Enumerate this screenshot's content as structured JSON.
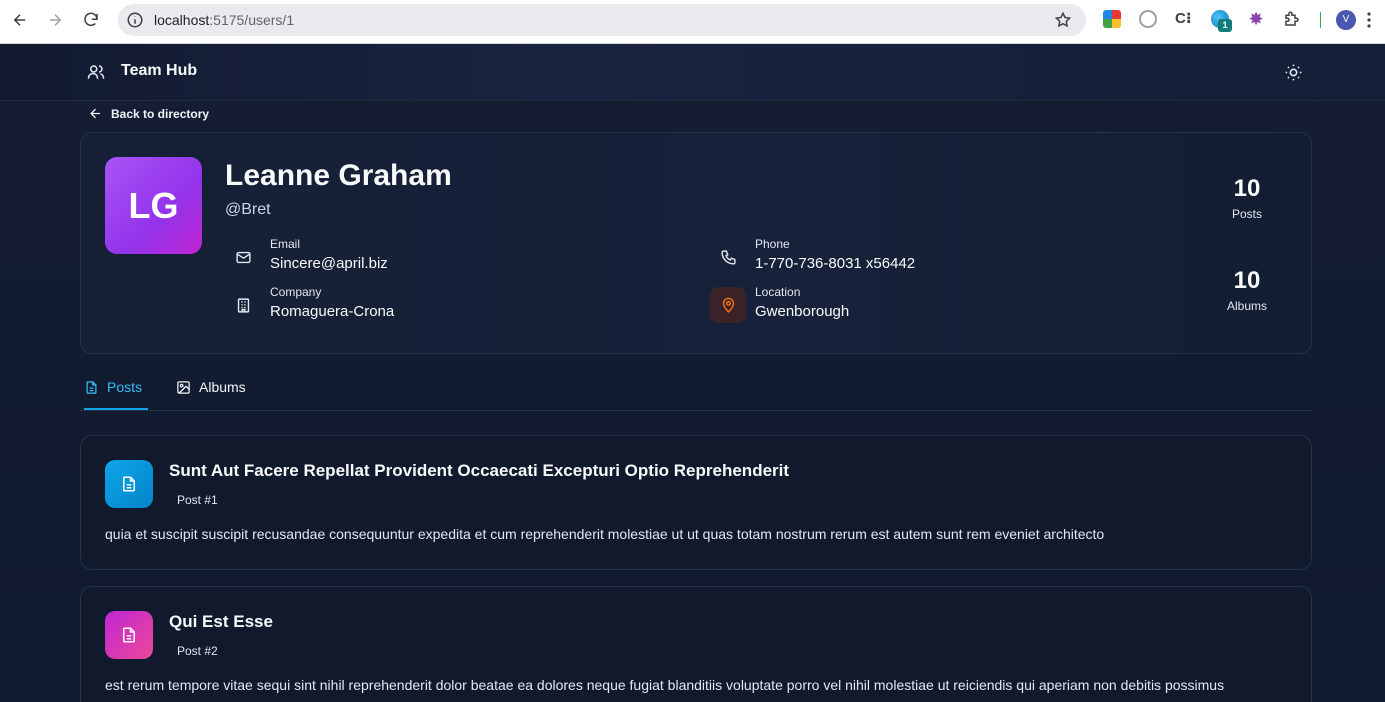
{
  "browser": {
    "url_host": "localhost",
    "url_path": ":5175/users/1",
    "extension_badge": "1",
    "profile_initial": "V"
  },
  "app": {
    "brand": "Team Hub",
    "back_label": "Back to directory"
  },
  "profile": {
    "initials": "LG",
    "name": "Leanne Graham",
    "handle": "@Bret",
    "email_label": "Email",
    "email": "Sincere@april.biz",
    "phone_label": "Phone",
    "phone": "1-770-736-8031 x56442",
    "company_label": "Company",
    "company": "Romaguera-Crona",
    "location_label": "Location",
    "location": "Gwenborough",
    "posts_count": "10",
    "posts_label": "Posts",
    "albums_count": "10",
    "albums_label": "Albums"
  },
  "tabs": [
    {
      "label": "Posts",
      "active": true
    },
    {
      "label": "Albums",
      "active": false
    }
  ],
  "posts": [
    {
      "title": "Sunt Aut Facere Repellat Provident Occaecati Excepturi Optio Reprehenderit",
      "number": "Post #1",
      "body": "quia et suscipit suscipit recusandae consequuntur expedita et cum reprehenderit molestiae ut ut quas totam nostrum rerum est autem sunt rem eveniet architecto"
    },
    {
      "title": "Qui Est Esse",
      "number": "Post #2",
      "body": "est rerum tempore vitae sequi sint nihil reprehenderit dolor beatae ea dolores neque fugiat blanditiis voluptate porro vel nihil molestiae ut reiciendis qui aperiam non debitis possimus"
    }
  ],
  "colors": {
    "accent": "#0ea5e9",
    "avatar": "#a855f7",
    "post1_icon": "#0ea5e9",
    "post2_icon": "#db2777",
    "location_icon": "#f97316"
  }
}
